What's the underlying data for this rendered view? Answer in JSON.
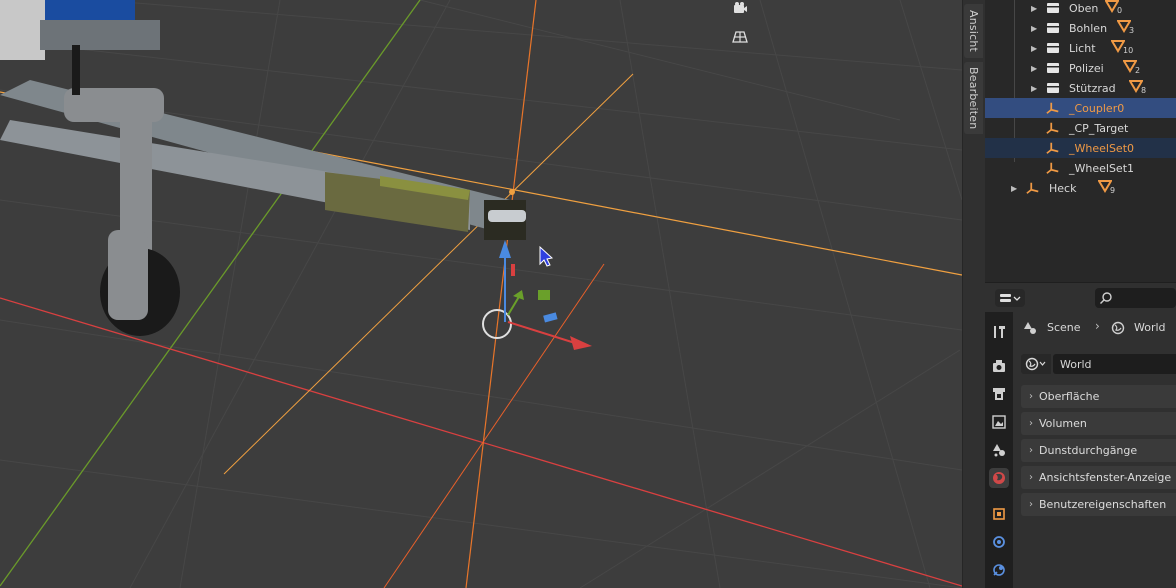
{
  "viewport": {
    "tabs": [
      "Ansicht",
      "Bearbeiten"
    ]
  },
  "outliner": {
    "rows": [
      {
        "label": "Oben",
        "count": "0",
        "type": "collection",
        "expand": true
      },
      {
        "label": "Bohlen",
        "count": "3",
        "type": "collection",
        "expand": true
      },
      {
        "label": "Licht",
        "count": "10",
        "type": "collection",
        "expand": true
      },
      {
        "label": "Polizei",
        "count": "2",
        "type": "collection",
        "expand": true
      },
      {
        "label": "Stützrad",
        "count": "8",
        "type": "collection",
        "expand": true
      },
      {
        "label": "_Coupler0",
        "count": "",
        "type": "empty",
        "expand": false,
        "state": "active"
      },
      {
        "label": "_CP_Target",
        "count": "",
        "type": "empty",
        "expand": false,
        "state": "none"
      },
      {
        "label": "_WheelSet0",
        "count": "",
        "type": "empty",
        "expand": false,
        "state": "selected"
      },
      {
        "label": "_WheelSet1",
        "count": "",
        "type": "empty",
        "expand": false,
        "state": "none"
      },
      {
        "label": "Heck",
        "count": "9",
        "type": "empty",
        "expand": true,
        "state": "none"
      }
    ]
  },
  "properties": {
    "breadcrumb": {
      "scene": "Scene",
      "world": "World"
    },
    "world_field": "World",
    "panels": [
      "Oberfläche",
      "Volumen",
      "Dunstdurchgänge",
      "Ansichtsfenster-Anzeige",
      "Benutzereigenschaften"
    ],
    "tabs": [
      "tool-icon",
      "render-icon",
      "output-icon",
      "view-layer-icon",
      "scene-icon",
      "world-icon",
      "object-icon",
      "modifier-icon",
      "physics-icon"
    ]
  },
  "colors": {
    "accent_orange": "#f09a45",
    "selection_blue": "#334d80",
    "axis_red": "#d94040",
    "axis_green": "#6a9a2a",
    "axis_blue": "#4a8ae0"
  }
}
